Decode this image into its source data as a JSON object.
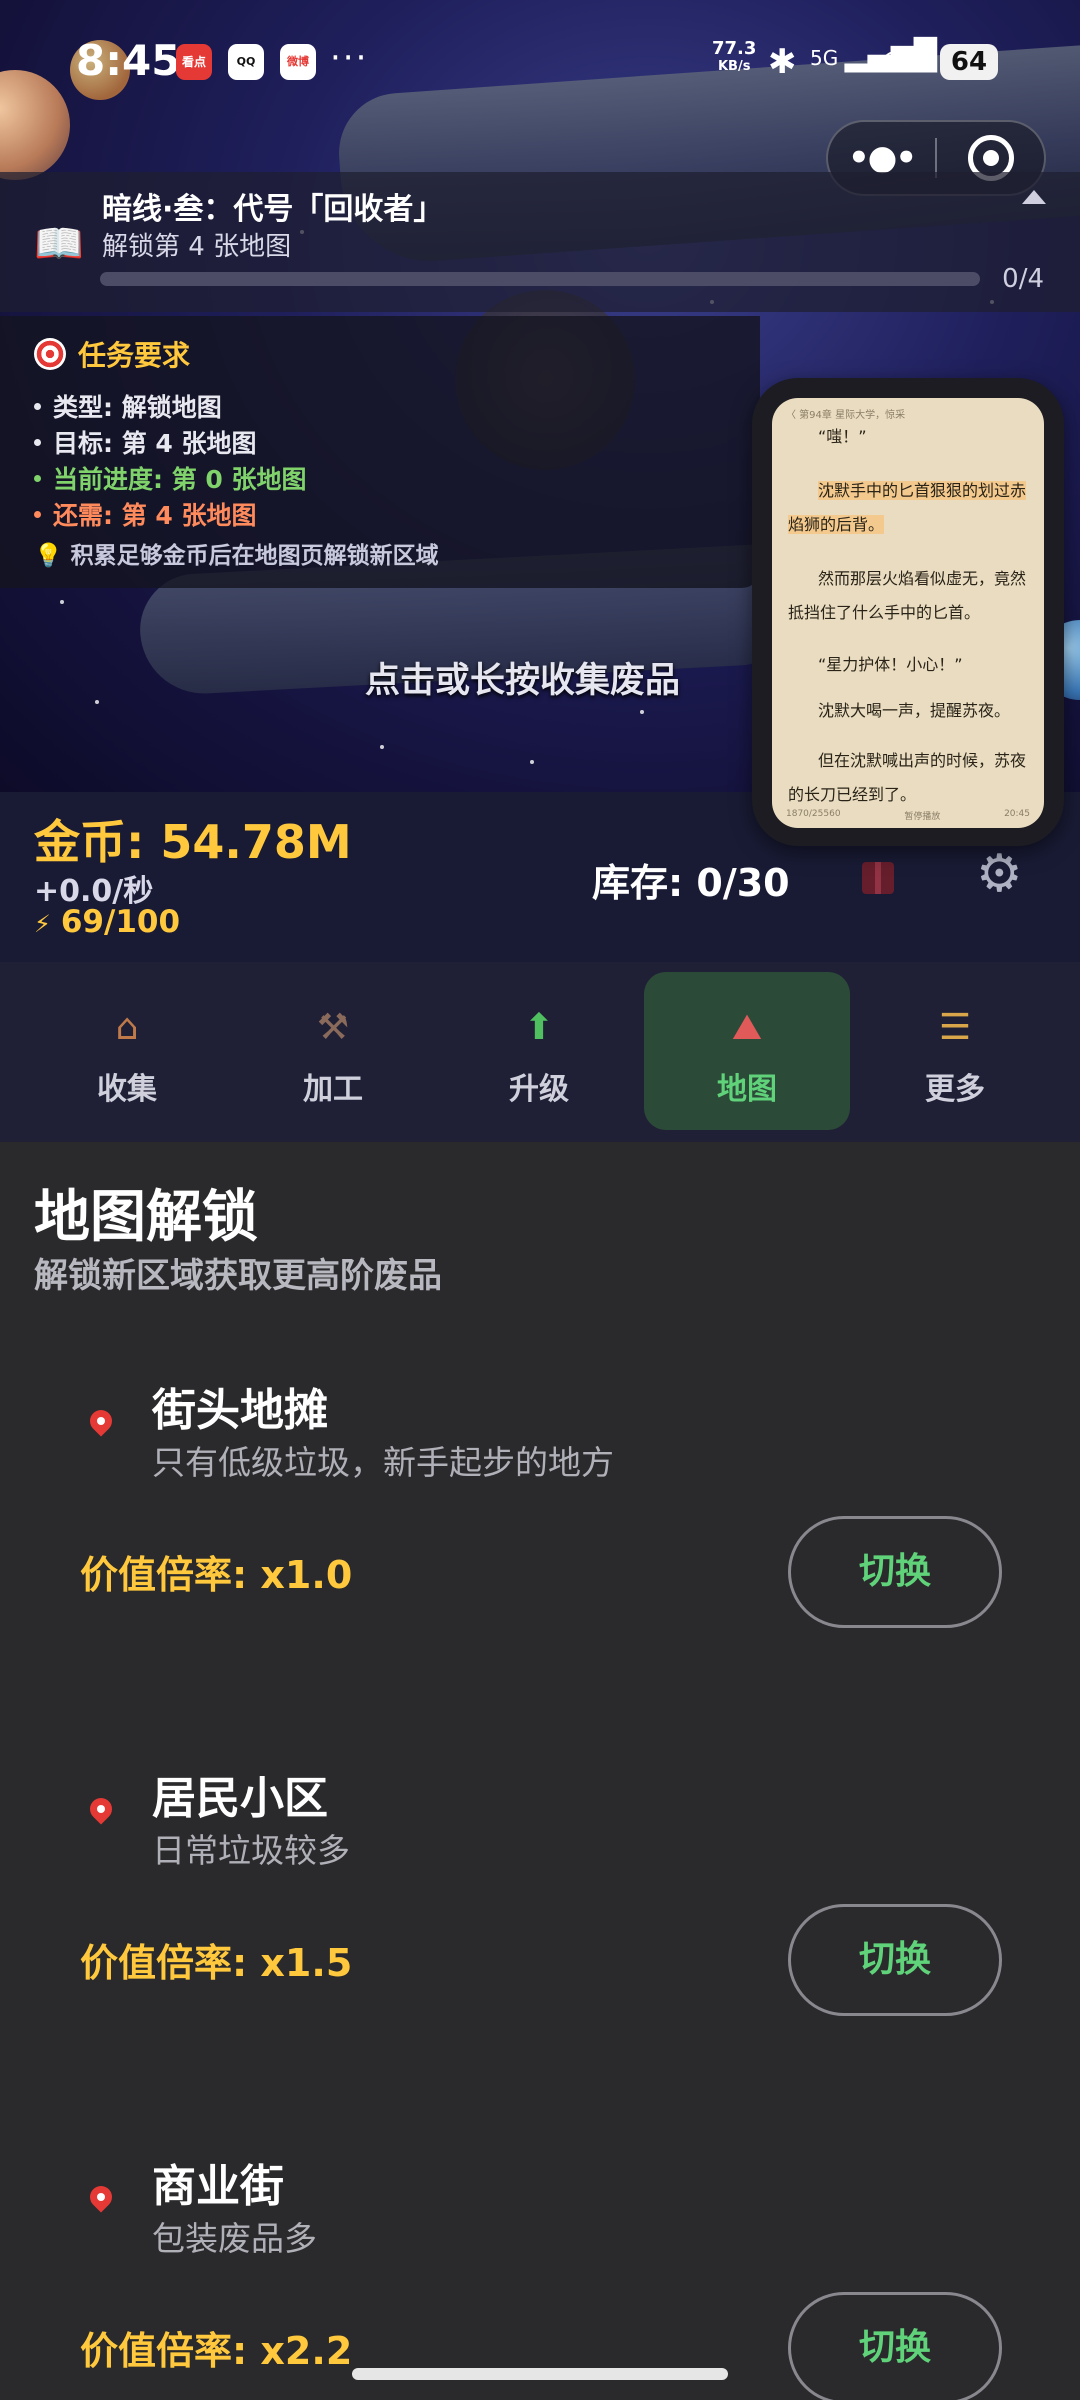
{
  "status_bar": {
    "time": "8:45",
    "app_icons": [
      "看点",
      "QQ",
      "微博"
    ],
    "more_dots": "···",
    "network_speed": "77.3",
    "network_unit": "KB/s",
    "network_type": "5G",
    "battery": "64"
  },
  "quest": {
    "title": "暗线·叁：代号「回收者」",
    "subtitle": "解锁第 4 张地图",
    "progress_text": "0/4",
    "progress": 0
  },
  "task": {
    "header": "任务要求",
    "lines": [
      {
        "text": "类型: 解锁地图",
        "color": "#e8e8f0"
      },
      {
        "text": "目标: 第 4 张地图",
        "color": "#e8e8f0"
      },
      {
        "text": "当前进度: 第 0 张地图",
        "color": "#7fd36a"
      },
      {
        "text": "还需: 第 4 张地图",
        "color": "#ff8a5c"
      }
    ],
    "hint": "积累足够金币后在地图页解锁新区域"
  },
  "scene": {
    "collect_prompt": "点击或长按收集废品"
  },
  "reader": {
    "top_meta": "〈 第94章 星际大学，惊采",
    "paragraphs": [
      "“嗤！”",
      "沈默手中的匕首狠狠的划过赤焰狮的后背。",
      "然而那层火焰看似虚无，竟然抵挡住了什么手中的匕首。",
      "“星力护体！小心！”",
      "沈默大喝一声，提醒苏夜。",
      "但在沈默喊出声的时候，苏夜的长刀已经到了。"
    ],
    "foot_left": "1870/25560",
    "foot_mid": "暂停播放",
    "foot_right": "20:45"
  },
  "stats": {
    "gold": "金币: 54.78M",
    "rate": "+0.0/秒",
    "energy": "69/100",
    "stock": "库存: 0/30"
  },
  "tabs": [
    {
      "label": "收集",
      "icon": "🏚",
      "active": false
    },
    {
      "label": "加工",
      "icon": "🔨",
      "active": false
    },
    {
      "label": "升级",
      "icon": "⬆",
      "active": false
    },
    {
      "label": "地图",
      "icon": "📍",
      "active": true
    },
    {
      "label": "更多",
      "icon": "≡",
      "active": false
    }
  ],
  "map_page": {
    "title": "地图解锁",
    "subtitle": "解锁新区域获取更高阶废品",
    "maps": [
      {
        "name": "街头地摊",
        "desc": "只有低级垃圾，新手起步的地方",
        "multiplier": "价值倍率: x1.0",
        "button": "切换"
      },
      {
        "name": "居民小区",
        "desc": "日常垃圾较多",
        "multiplier": "价值倍率: x1.5",
        "button": "切换"
      },
      {
        "name": "商业街",
        "desc": "包装废品多",
        "multiplier": "价值倍率: x2.2",
        "button": "切换"
      }
    ]
  },
  "colors": {
    "gold": "#ffc83d",
    "accent_green": "#5fd27a",
    "active_tab_bg": "#2c4a38",
    "content_bg": "#2a2a2c"
  }
}
